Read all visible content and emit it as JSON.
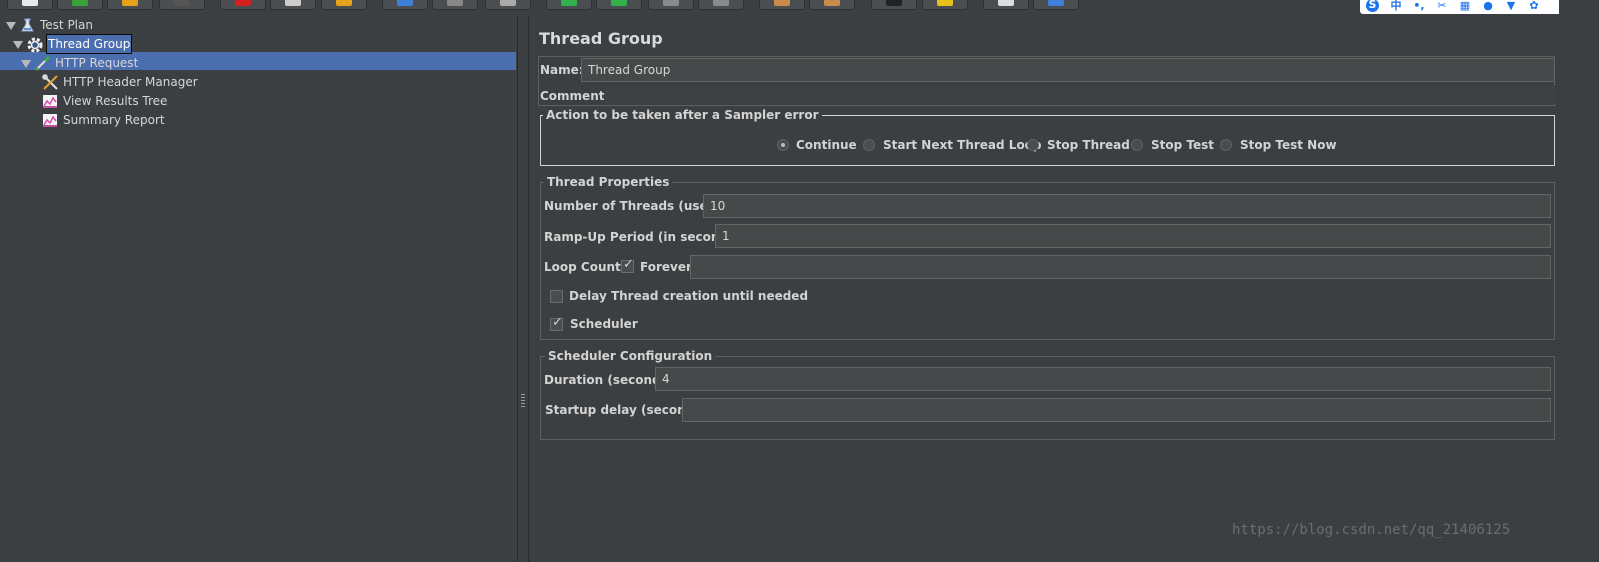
{
  "toolbar": {
    "buttons": [
      {
        "icon": "new-icon",
        "color": "#e8e8e8"
      },
      {
        "icon": "templates-icon",
        "color": "#3aa23a"
      },
      {
        "icon": "open-icon",
        "color": "#e6a21c"
      },
      {
        "icon": "save-icon",
        "color": "#555555"
      },
      {
        "icon": "cut-icon",
        "color": "#d42020"
      },
      {
        "icon": "copy-icon",
        "color": "#cccccc"
      },
      {
        "icon": "paste-icon",
        "color": "#e6a21c"
      },
      {
        "icon": "expand-icon",
        "color": "#3d7fd8"
      },
      {
        "icon": "collapse-icon",
        "color": "#888888"
      },
      {
        "icon": "toggle-icon",
        "color": "#aaaaaa"
      },
      {
        "icon": "start-icon",
        "color": "#2fb34a"
      },
      {
        "icon": "start-no-pauses-icon",
        "color": "#2fb34a"
      },
      {
        "icon": "stop-icon",
        "color": "#8a8a8a"
      },
      {
        "icon": "shutdown-icon",
        "color": "#8a8a8a"
      },
      {
        "icon": "clear-icon",
        "color": "#c98a4a"
      },
      {
        "icon": "clear-all-icon",
        "color": "#c98a4a"
      },
      {
        "icon": "search-icon",
        "color": "#222222"
      },
      {
        "icon": "reset-search-icon",
        "color": "#e6c21c"
      },
      {
        "icon": "function-helper-icon",
        "color": "#dddddd"
      },
      {
        "icon": "help-icon",
        "color": "#3d7fd8"
      }
    ]
  },
  "ime_bar": {
    "items": [
      {
        "icon": "sogou-logo-icon",
        "glyph": "S"
      },
      {
        "icon": "chinese-mode-icon",
        "glyph": "中"
      },
      {
        "icon": "punctuation-icon",
        "glyph": "•,"
      },
      {
        "icon": "scissors-icon",
        "glyph": "✂"
      },
      {
        "icon": "keyboard-icon",
        "glyph": "▦"
      },
      {
        "icon": "user-icon",
        "glyph": "●"
      },
      {
        "icon": "shirt-icon",
        "glyph": "▼"
      },
      {
        "icon": "settings-icon",
        "glyph": "✿"
      }
    ]
  },
  "tree": {
    "items": [
      {
        "label": "Test Plan",
        "icon": "test-plan-icon",
        "expanded": true
      },
      {
        "label": "Thread Group",
        "icon": "thread-group-gear-icon",
        "expanded": true,
        "selected": true
      },
      {
        "label": "HTTP Request",
        "icon": "http-request-pipette-icon",
        "expanded": true
      },
      {
        "label": "HTTP Header Manager",
        "icon": "header-manager-tools-icon"
      },
      {
        "label": "View Results Tree",
        "icon": "view-results-tree-chart-icon"
      },
      {
        "label": "Summary Report",
        "icon": "summary-report-chart-icon"
      }
    ]
  },
  "panel": {
    "title": "Thread Group",
    "name_label": "Name:",
    "name_value": "Thread Group",
    "comments_label": "Comments:",
    "comments_value": "",
    "sampler_error": {
      "legend": "Action to be taken after a Sampler error",
      "options": [
        {
          "label": "Continue",
          "selected": true
        },
        {
          "label": "Start Next Thread Loop",
          "selected": false
        },
        {
          "label": "Stop Thread",
          "selected": false
        },
        {
          "label": "Stop Test",
          "selected": false
        },
        {
          "label": "Stop Test Now",
          "selected": false
        }
      ]
    },
    "thread_properties": {
      "legend": "Thread Properties",
      "threads_label": "Number of Threads (users):",
      "threads_value": "10",
      "rampup_label": "Ramp-Up Period (in seconds):",
      "rampup_value": "1",
      "loop_label": "Loop Count:",
      "forever_label": "Forever",
      "forever_checked": true,
      "loop_value": "",
      "delay_label": "Delay Thread creation until needed",
      "delay_checked": false,
      "scheduler_label": "Scheduler",
      "scheduler_checked": true
    },
    "scheduler_config": {
      "legend": "Scheduler Configuration",
      "duration_label": "Duration (seconds)",
      "duration_value": "4",
      "startup_label": "Startup delay (seconds)",
      "startup_value": ""
    }
  },
  "watermark": "https://blog.csdn.net/qq_21406125"
}
